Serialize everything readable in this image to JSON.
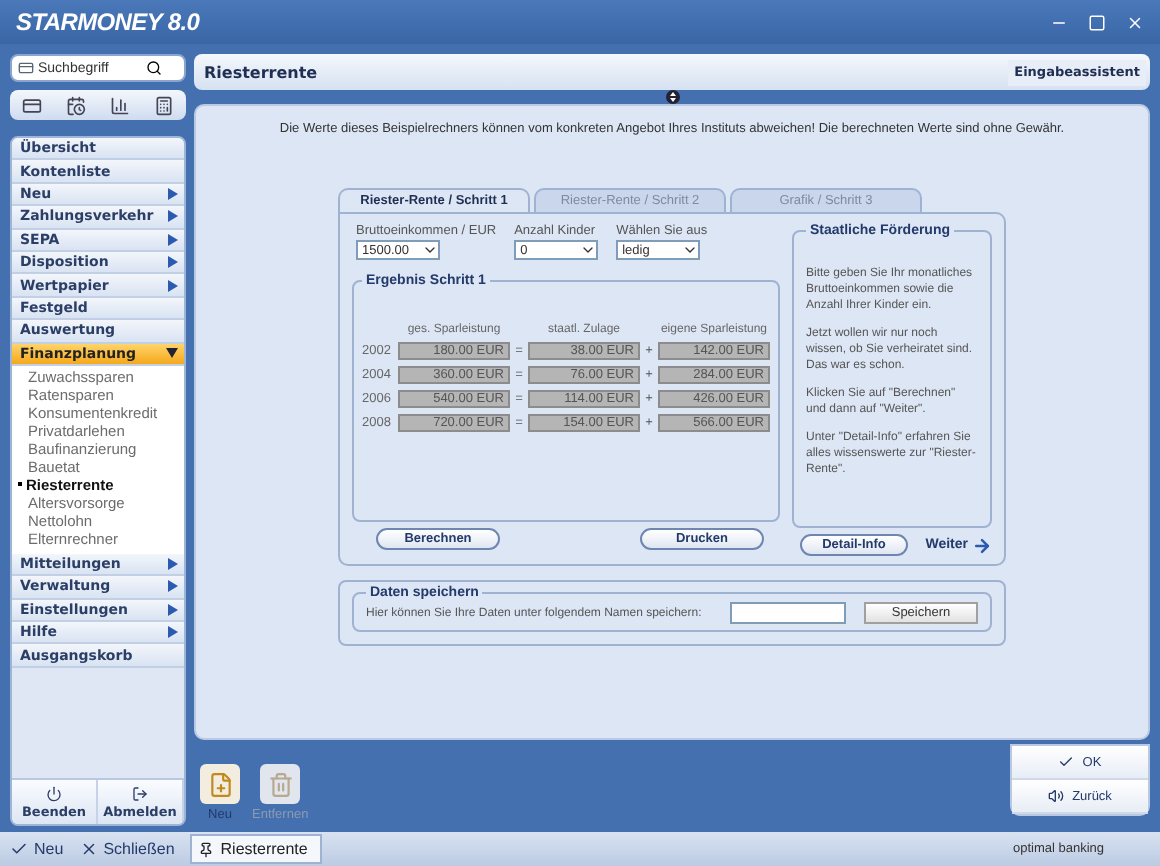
{
  "window": {
    "logo": "STARMONEY 8.0"
  },
  "search": {
    "placeholder": "Suchbegriff"
  },
  "sidebar": {
    "items": [
      {
        "label": "Übersicht",
        "kind": "link"
      },
      {
        "label": "Kontenliste",
        "kind": "link"
      },
      {
        "label": "Neu",
        "kind": "submenu",
        "expanded": false
      },
      {
        "label": "Zahlungsverkehr",
        "kind": "submenu",
        "expanded": false
      },
      {
        "label": "SEPA",
        "kind": "submenu",
        "expanded": false
      },
      {
        "label": "Disposition",
        "kind": "submenu",
        "expanded": false
      },
      {
        "label": "Wertpapier",
        "kind": "submenu",
        "expanded": false
      },
      {
        "label": "Festgeld",
        "kind": "link"
      },
      {
        "label": "Auswertung",
        "kind": "link"
      },
      {
        "label": "Finanzplanung",
        "kind": "submenu",
        "expanded": true,
        "children": [
          {
            "label": "Zuwachssparen",
            "selected": false
          },
          {
            "label": "Ratensparen",
            "selected": false
          },
          {
            "label": "Konsumentenkredit",
            "selected": false
          },
          {
            "label": "Privatdarlehen",
            "selected": false
          },
          {
            "label": "Baufinanzierung",
            "selected": false
          },
          {
            "label": "Bauetat",
            "selected": false
          },
          {
            "label": "Riesterrente",
            "selected": true
          },
          {
            "label": "Altersvorsorge",
            "selected": false
          },
          {
            "label": "Nettolohn",
            "selected": false
          },
          {
            "label": "Elternrechner",
            "selected": false
          }
        ]
      },
      {
        "label": "Mitteilungen",
        "kind": "submenu",
        "expanded": false
      },
      {
        "label": "Verwaltung",
        "kind": "submenu",
        "expanded": false
      },
      {
        "label": "Einstellungen",
        "kind": "submenu",
        "expanded": false
      },
      {
        "label": "Hilfe",
        "kind": "submenu",
        "expanded": false
      },
      {
        "label": "Ausgangskorb",
        "kind": "link"
      }
    ],
    "footer_buttons": [
      "Beenden",
      "Abmelden"
    ]
  },
  "header": {
    "title": "Riesterrente",
    "assistant_button": "Eingabeassistent"
  },
  "notice": "Die Werte dieses Beispielrechners können vom konkreten Angebot Ihres Instituts abweichen! Die berechneten Werte sind ohne Gewähr.",
  "tabs": [
    {
      "label": "Riester-Rente / Schritt 1",
      "selected": true
    },
    {
      "label": "Riester-Rente / Schritt 2",
      "selected": false
    },
    {
      "label": "Grafik / Schritt 3",
      "selected": false
    }
  ],
  "form": [
    {
      "label": "Bruttoeinkommen / EUR",
      "value": "1500.00"
    },
    {
      "label": "Anzahl Kinder",
      "value": "0"
    },
    {
      "label": "Wählen Sie aus",
      "value": "ledig"
    }
  ],
  "result": {
    "title": "Ergebnis Schritt 1",
    "columns": [
      "ges. Sparleistung",
      "staatl. Zulage",
      "eigene Sparleistung"
    ],
    "rows": [
      {
        "year": "2002",
        "total": "180.00 EUR",
        "op1": "=",
        "subsidy": "38.00 EUR",
        "op2": "+",
        "own": "142.00 EUR"
      },
      {
        "year": "2004",
        "total": "360.00 EUR",
        "op1": "=",
        "subsidy": "76.00 EUR",
        "op2": "+",
        "own": "284.00 EUR"
      },
      {
        "year": "2006",
        "total": "540.00 EUR",
        "op1": "=",
        "subsidy": "114.00 EUR",
        "op2": "+",
        "own": "426.00 EUR"
      },
      {
        "year": "2008",
        "total": "720.00 EUR",
        "op1": "=",
        "subsidy": "154.00 EUR",
        "op2": "+",
        "own": "566.00 EUR"
      }
    ]
  },
  "buttons": [
    "Berechnen",
    "Drucken"
  ],
  "info": {
    "title": "Staatliche Förderung",
    "paragraphs": [
      "Bitte geben Sie Ihr monatliches Bruttoeinkommen sowie die Anzahl Ihrer Kinder ein.",
      "Jetzt wollen wir nur noch wissen, ob Sie verheiratet sind. Das war es schon.",
      "Klicken Sie auf \"Berechnen\" und dann auf \"Weiter\".",
      "Unter \"Detail-Info\" erfahren Sie alles wissenswerte zur \"Riester-Rente\"."
    ],
    "button": "Detail-Info",
    "next": "Weiter"
  },
  "save": {
    "title": "Daten speichern",
    "text": "Hier können Sie Ihre Daten unter folgendem Namen speichern:",
    "button": "Speichern"
  },
  "toolbar": [
    {
      "label": "Neu",
      "kind": "new",
      "disabled": false
    },
    {
      "label": "Entfernen",
      "kind": "delete",
      "disabled": true
    }
  ],
  "actions": [
    {
      "label": "OK",
      "kind": "ok"
    },
    {
      "label": "Zurück",
      "kind": "back"
    }
  ],
  "status_bar": {
    "items": [
      {
        "label": "Neu",
        "kind": "check"
      },
      {
        "label": "Schließen",
        "kind": "close"
      }
    ],
    "tabs": [
      {
        "label": "Riesterrente",
        "selected": true
      }
    ],
    "brand": "optimal banking"
  }
}
